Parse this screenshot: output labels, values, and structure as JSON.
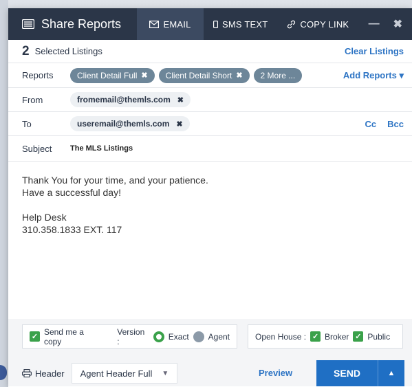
{
  "window": {
    "title": "Share Reports",
    "tabs": [
      {
        "label": "EMAIL",
        "icon": "envelope-icon",
        "active": true
      },
      {
        "label": "SMS TEXT",
        "icon": "phone-icon",
        "active": false
      },
      {
        "label": "COPY LINK",
        "icon": "link-icon",
        "active": false
      }
    ],
    "minimize": "—",
    "close": "✖"
  },
  "selected": {
    "count": "2",
    "label": "Selected Listings",
    "clear_link": "Clear Listings"
  },
  "reports": {
    "label": "Reports",
    "chips": [
      "Client Detail Full",
      "Client Detail Short",
      "2 More ..."
    ],
    "add_link": "Add Reports ▾"
  },
  "from": {
    "label": "From",
    "email": "fromemail@themls.com"
  },
  "to": {
    "label": "To",
    "email": "useremail@themls.com",
    "cc": "Cc",
    "bcc": "Bcc"
  },
  "subject": {
    "label": "Subject",
    "value": "The MLS Listings"
  },
  "message": {
    "line1": "Thank You for your time, and your patience.",
    "line2": "Have a successful day!",
    "line3": "Help Desk",
    "line4": "310.358.1833 EXT. 117"
  },
  "options": {
    "send_copy": "Send me a copy",
    "version_label": "Version :",
    "version_exact": "Exact",
    "version_agent": "Agent",
    "open_house_label": "Open House :",
    "broker": "Broker",
    "public": "Public"
  },
  "footer": {
    "header_label": "Header",
    "header_select": "Agent Header Full",
    "preview": "Preview",
    "send": "SEND"
  },
  "colors": {
    "titlebar": "#2b3648",
    "active_tab": "#3c4a61",
    "link": "#2d74c4",
    "chip": "#6d8699",
    "check": "#3aa14a",
    "send": "#1f6fc4"
  }
}
